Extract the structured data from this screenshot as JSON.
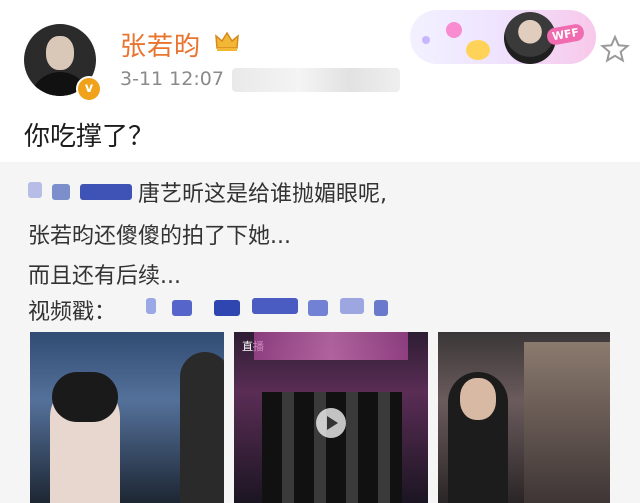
{
  "post": {
    "username": "张若昀",
    "timestamp": "3-11 12:07",
    "text": "你吃撑了？",
    "fan_badge": "WFF"
  },
  "repost": {
    "line1_text": "唐艺昕这是给谁抛媚眼呢,",
    "line2_text": "张若昀还傻傻的拍了下她...",
    "line3_text": "而且还有后续...",
    "video_label": "视频戳："
  },
  "media": {
    "thumb2_label": "直播"
  },
  "icons": {
    "crown": "crown-icon",
    "star": "star-icon",
    "verified": "verified-badge-icon",
    "play": "play-icon"
  },
  "colors": {
    "username": "#e8742f",
    "timestamp": "#8a8a8a",
    "repost_bg": "#f5f5f5"
  }
}
